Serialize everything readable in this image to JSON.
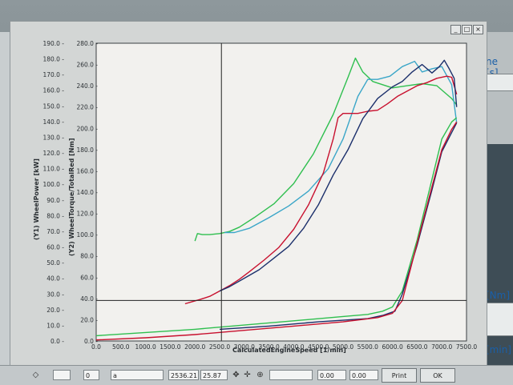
{
  "background": {
    "right_label_seconds": "ne [s]",
    "right_label_nm": "[Nm]",
    "right_label_min": "[min]"
  },
  "window": {
    "controls": [
      "_",
      "□",
      "×"
    ]
  },
  "chart_data": {
    "type": "line",
    "xlabel": "CalculatedEngineSpeed [1/min]",
    "y1label": "(Y1)  WheelPower [kW]",
    "y2label": "(Y2)  WheelTorque/TotalRed [Nm]",
    "xlim": [
      0,
      7500
    ],
    "y1lim": [
      0,
      190
    ],
    "y2lim": [
      0,
      280
    ],
    "x_ticks": [
      "0.0",
      "500.0",
      "1000.0",
      "1500.0",
      "2000.0",
      "2500.0",
      "3000.0",
      "3500.0",
      "4000.0",
      "4500.0",
      "5000.0",
      "5500.0",
      "6000.0",
      "6500.0",
      "7000.0",
      "7500.0"
    ],
    "y1_ticks": [
      "0.0",
      "10.0",
      "20.0",
      "30.0",
      "40.0",
      "50.0",
      "60.0",
      "70.0",
      "80.0",
      "90.0",
      "100.0",
      "110.0",
      "120.0",
      "130.0",
      "140.0",
      "150.0",
      "160.0",
      "170.0",
      "180.0",
      "190.0"
    ],
    "y2_ticks": [
      "0.0",
      "20.0",
      "40.0",
      "60.0",
      "80.0",
      "100.0",
      "120.0",
      "140.0",
      "160.0",
      "180.0",
      "200.0",
      "220.0",
      "240.0",
      "260.0",
      "280.0"
    ],
    "cursor": {
      "x": 2536.21,
      "y1": 25.87
    },
    "grid": false,
    "colors": {
      "green": "#2fbf4f",
      "cyan": "#3aa6c8",
      "red": "#c8102e",
      "navy": "#1b2f6b"
    },
    "series": [
      {
        "color": "green",
        "axis": "y2",
        "x": [
          2000,
          2050,
          2150,
          2300,
          2500,
          2700,
          2900,
          3200,
          3600,
          4000,
          4400,
          4800,
          5100,
          5250,
          5400,
          5600,
          6000,
          6300,
          6600,
          6900,
          7200,
          7300
        ],
        "y": [
          94,
          101,
          100,
          100,
          101,
          103,
          107,
          116,
          129,
          148,
          176,
          213,
          248,
          266,
          253,
          244,
          238,
          240,
          242,
          240,
          228,
          222
        ]
      },
      {
        "color": "cyan",
        "axis": "y2",
        "x": [
          2600,
          2800,
          3100,
          3500,
          3900,
          4300,
          4700,
          5000,
          5300,
          5500,
          5700,
          5950,
          6200,
          6450,
          6600,
          6800,
          7000,
          7200,
          7300
        ],
        "y": [
          102,
          102,
          106,
          116,
          127,
          141,
          162,
          190,
          230,
          246,
          246,
          249,
          258,
          263,
          253,
          256,
          258,
          241,
          205
        ]
      },
      {
        "color": "red",
        "axis": "y2",
        "x": [
          1800,
          1950,
          2100,
          2300,
          2500,
          2700,
          2900,
          3100,
          3400,
          3700,
          4000,
          4300,
          4600,
          4800,
          4900,
          5000,
          5300,
          5500,
          5700,
          5900,
          6100,
          6300,
          6500,
          6700,
          6900,
          7100,
          7200,
          7300
        ],
        "y": [
          35,
          37,
          39,
          42,
          47,
          52,
          58,
          65,
          76,
          88,
          105,
          128,
          158,
          190,
          210,
          214,
          214,
          216,
          217,
          223,
          230,
          235,
          240,
          243,
          247,
          249,
          248,
          232
        ]
      },
      {
        "color": "navy",
        "axis": "y2",
        "x": [
          2500,
          2700,
          3000,
          3300,
          3600,
          3900,
          4200,
          4500,
          4800,
          5100,
          5400,
          5700,
          6000,
          6200,
          6400,
          6600,
          6800,
          6950,
          7050,
          7150,
          7250,
          7300
        ],
        "y": [
          47,
          51,
          59,
          67,
          78,
          89,
          106,
          128,
          156,
          180,
          209,
          228,
          239,
          244,
          253,
          260,
          252,
          258,
          264,
          256,
          247,
          220
        ]
      },
      {
        "color": "green",
        "axis": "y2",
        "x": [
          0,
          1000,
          2000,
          3000,
          4000,
          5000,
          5500,
          5800,
          6000,
          6200,
          6500,
          6800,
          7000,
          7200,
          7300
        ],
        "y": [
          5,
          8,
          11,
          15,
          19,
          23,
          25,
          28,
          32,
          47,
          95,
          152,
          190,
          206,
          210
        ]
      },
      {
        "color": "navy",
        "axis": "y2",
        "x": [
          2500,
          3500,
          4500,
          5500,
          5800,
          6050,
          6200,
          6500,
          6800,
          7000,
          7200,
          7300
        ],
        "y": [
          11,
          14,
          18,
          21,
          24,
          28,
          44,
          90,
          142,
          178,
          196,
          205
        ]
      },
      {
        "color": "red",
        "axis": "y2",
        "x": [
          0,
          1000,
          2000,
          3000,
          4000,
          5000,
          5700,
          6000,
          6200,
          6500,
          6800,
          7000,
          7200,
          7300
        ],
        "y": [
          1,
          3,
          6,
          10,
          14,
          18,
          22,
          26,
          38,
          92,
          145,
          180,
          199,
          206
        ]
      }
    ]
  },
  "bottom_bar": {
    "channel_value": "0",
    "name_value": "a",
    "cursor_x": "2536.21",
    "cursor_y": "25.87",
    "range_min": "0.00",
    "range_max": "0.00",
    "print_label": "Print",
    "ok_label": "OK"
  }
}
